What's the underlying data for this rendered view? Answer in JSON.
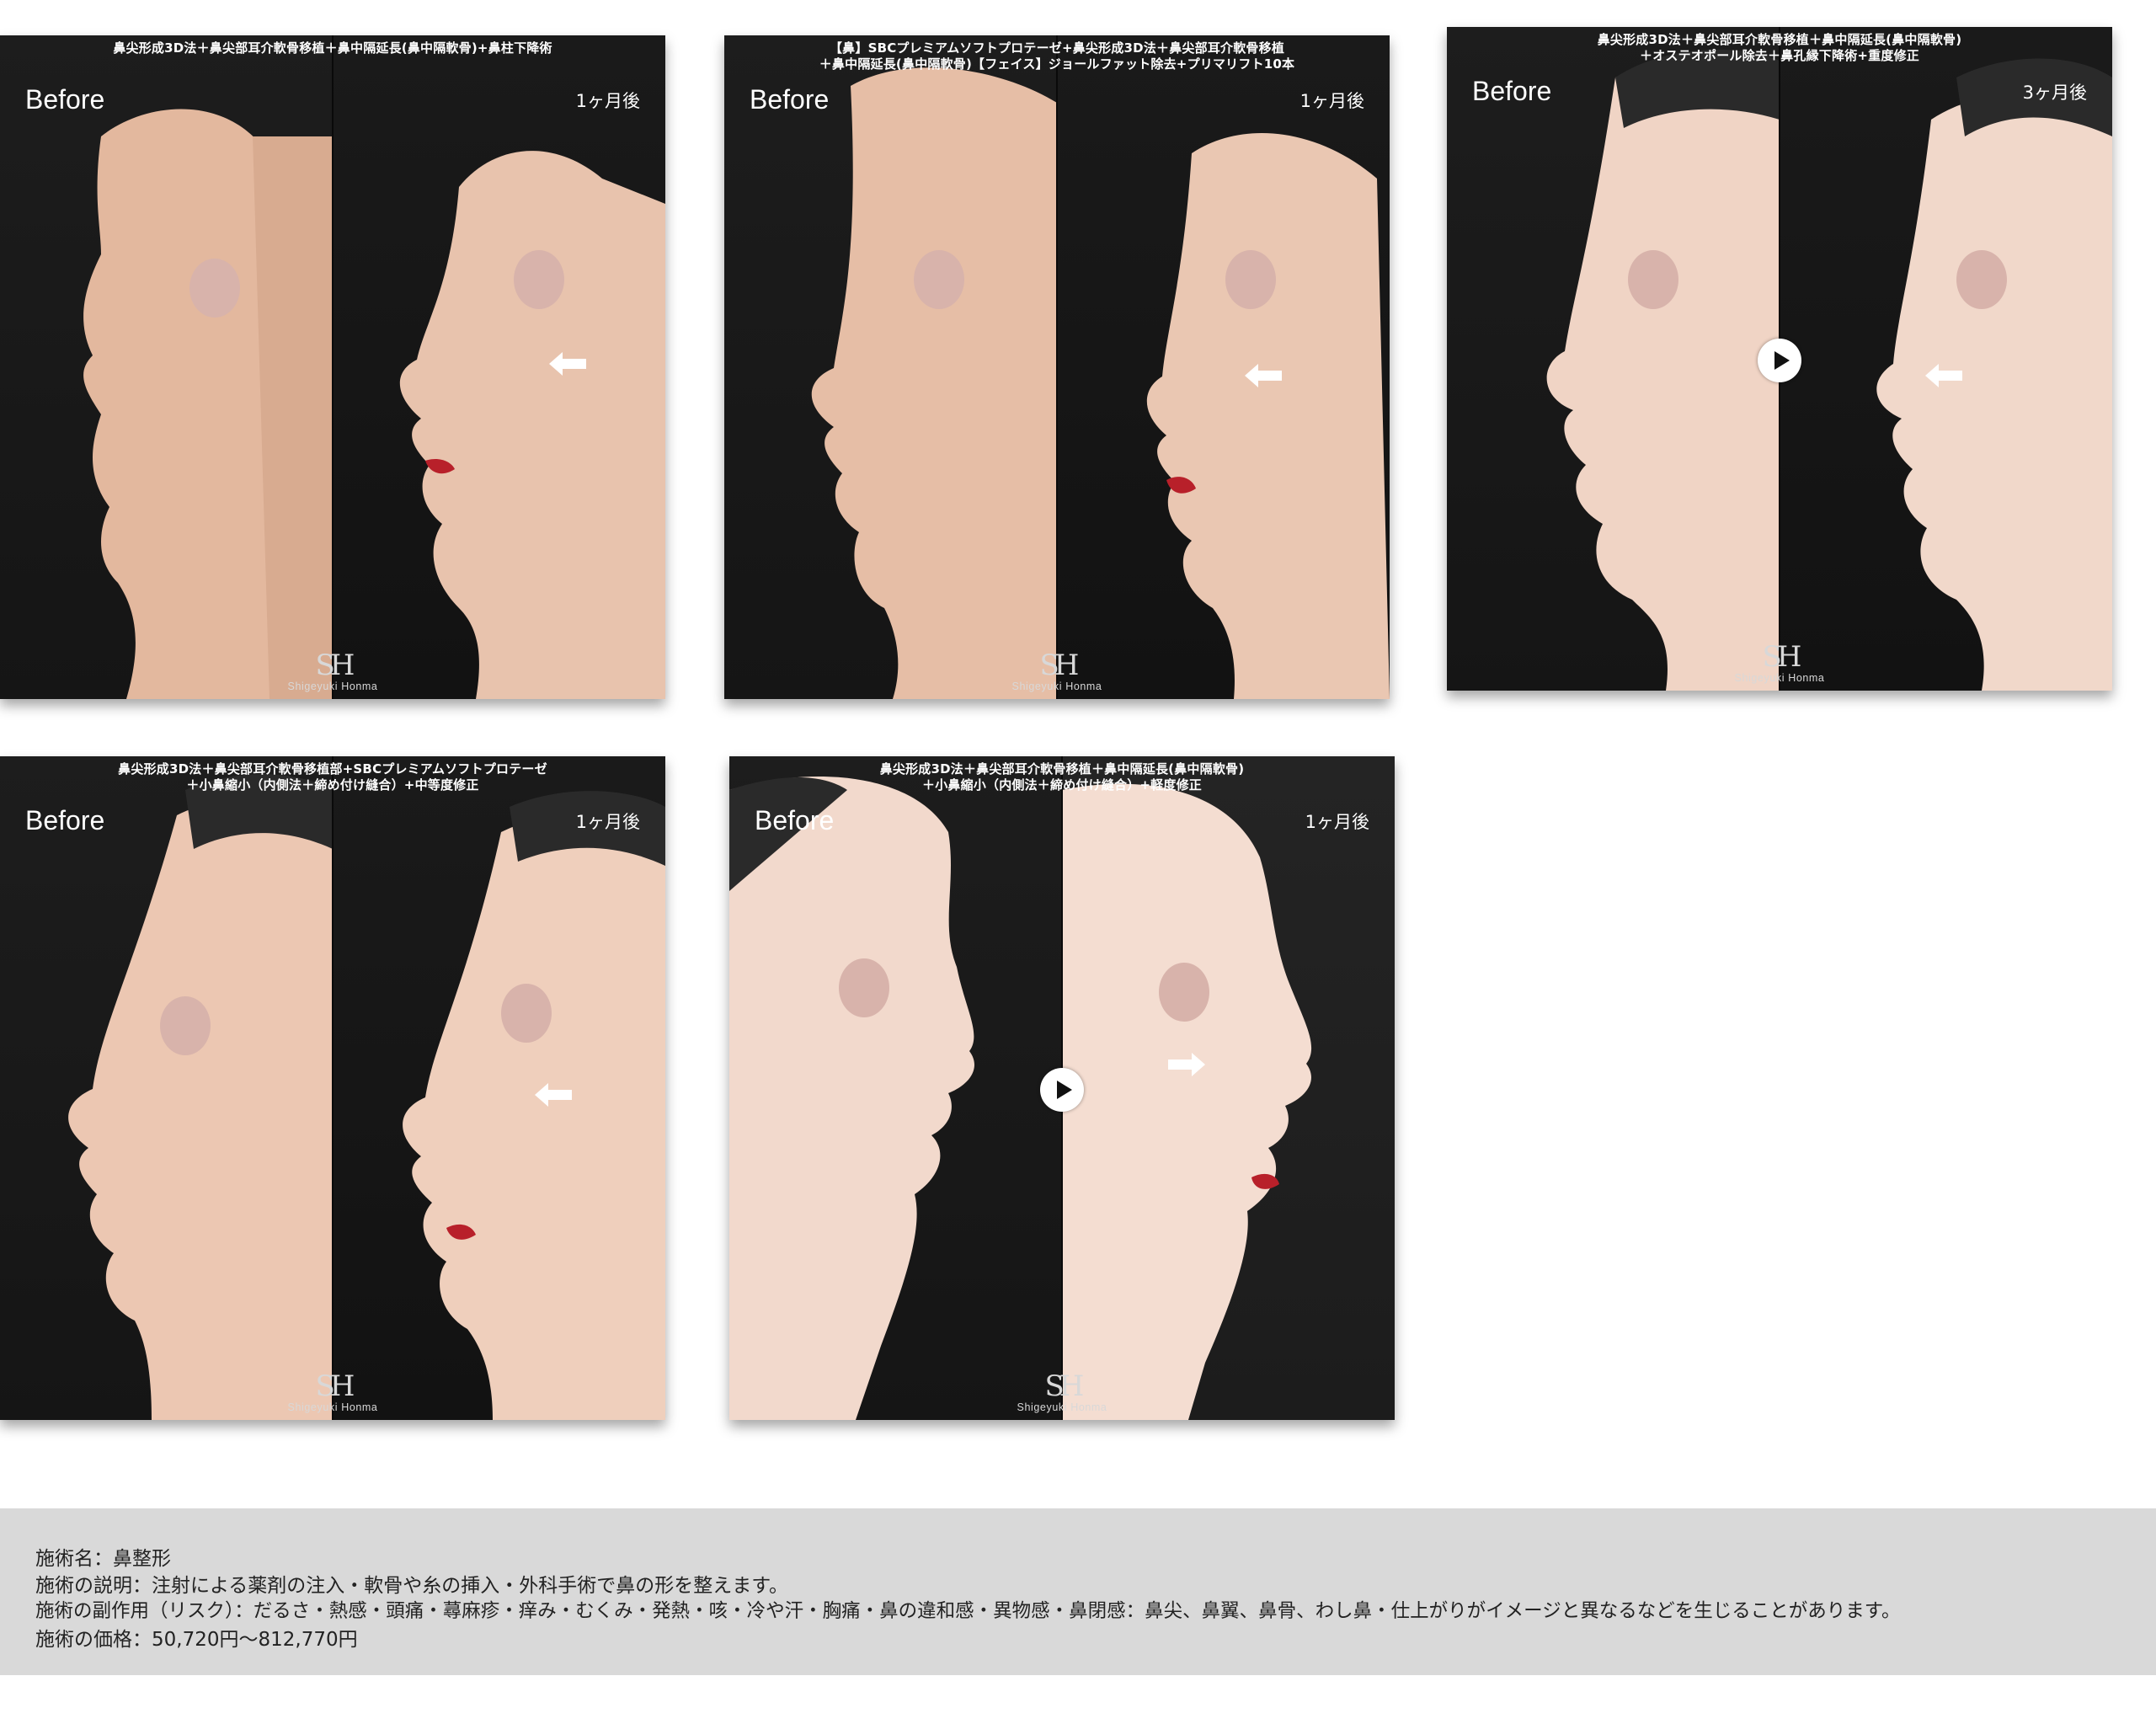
{
  "cards": [
    {
      "caption": "鼻尖形成3D法＋鼻尖部耳介軟骨移植＋鼻中隔延長(鼻中隔軟骨)+鼻柱下降術",
      "before": "Before",
      "after": "1ヶ月後",
      "logo_mono": "SH",
      "logo_name": "Shigeyuki Honma"
    },
    {
      "caption": "【鼻】SBCプレミアムソフトプロテーゼ+鼻尖形成3D法＋鼻尖部耳介軟骨移植\n＋鼻中隔延長(鼻中隔軟骨)【フェイス】ジョールファット除去+プリマリフト10本",
      "before": "Before",
      "after": "1ヶ月後",
      "logo_mono": "SH",
      "logo_name": "Shigeyuki Honma"
    },
    {
      "caption": "鼻尖形成3D法＋鼻尖部耳介軟骨移植＋鼻中隔延長(鼻中隔軟骨)\n＋オステオポール除去＋鼻孔縁下降術+重度修正",
      "before": "Before",
      "after": "3ヶ月後",
      "logo_mono": "SH",
      "logo_name": "Shigeyuki Honma"
    },
    {
      "caption": "鼻尖形成3D法＋鼻尖部耳介軟骨移植部+SBCプレミアムソフトプロテーゼ\n＋小鼻縮小（内側法＋締め付け縫合）+中等度修正",
      "before": "Before",
      "after": "1ヶ月後",
      "logo_mono": "SH",
      "logo_name": "Shigeyuki Honma"
    },
    {
      "caption": "鼻尖形成3D法＋鼻尖部耳介軟骨移植＋鼻中隔延長(鼻中隔軟骨)\n＋小鼻縮小（内側法＋締め付け縫合）+軽度修正",
      "before": "Before",
      "after": "1ヶ月後",
      "logo_mono": "SH",
      "logo_name": "Shigeyuki Honma"
    }
  ],
  "info": {
    "line1": "施術名：鼻整形",
    "line2": "施術の説明：注射による薬剤の注入・軟骨や糸の挿入・外科手術で鼻の形を整えます。",
    "line3": "施術の副作用（リスク）：だるさ・熱感・頭痛・蕁麻疹・痒み・むくみ・発熱・咳・冷や汗・胸痛・鼻の違和感・異物感・鼻閉感：鼻尖、鼻翼、鼻骨、わし鼻・仕上がりがイメージと異なるなどを生じることがあります。",
    "line4": "施術の価格：50,720円〜812,770円"
  },
  "icons": {
    "play": "play-icon",
    "arrow": "arrow-icon",
    "skin_color": "#e7c2ad",
    "lip_color": "#b8202a"
  }
}
